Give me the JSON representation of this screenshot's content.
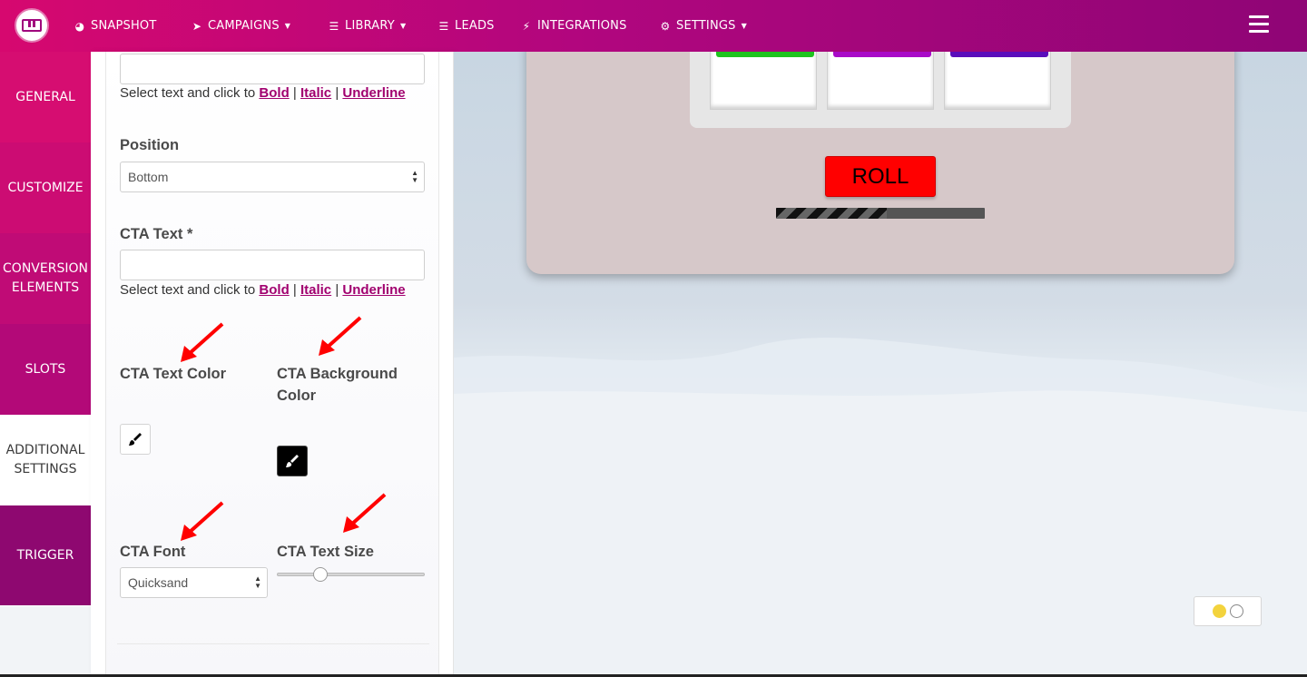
{
  "nav": {
    "items": [
      {
        "label": "SNAPSHOT",
        "icon": "dashboard-icon"
      },
      {
        "label": "CAMPAIGNS",
        "icon": "paper-plane-icon"
      },
      {
        "label": "LIBRARY",
        "icon": "list-icon"
      },
      {
        "label": "LEADS",
        "icon": "list-icon"
      },
      {
        "label": "INTEGRATIONS",
        "icon": "plug-icon"
      },
      {
        "label": "SETTINGS",
        "icon": "gears-icon"
      }
    ]
  },
  "sidebar": {
    "items": [
      {
        "label": "GENERAL"
      },
      {
        "label": "CUSTOMIZE"
      },
      {
        "label": "CONVERSION ELEMENTS"
      },
      {
        "label": "SLOTS"
      },
      {
        "label": "ADDITIONAL SETTINGS",
        "active": true
      },
      {
        "label": "TRIGGER"
      }
    ]
  },
  "form": {
    "top_input_value": "",
    "hint1": {
      "prefix": "Select text and click to ",
      "bold": "Bold",
      "sep1": " | ",
      "italic": "Italic",
      "sep2": " | ",
      "underline": "Underline"
    },
    "position_label": "Position",
    "position_value": "Bottom",
    "cta_text_label": "CTA Text *",
    "cta_text_value": "",
    "hint2": {
      "prefix": "Select text and click to ",
      "bold": "Bold",
      "sep1": " | ",
      "italic": "Italic",
      "sep2": " | ",
      "underline": "Underline"
    },
    "cta_text_color_label": "CTA Text Color",
    "cta_bg_color_label": "CTA Background Color",
    "cta_font_label": "CTA Font",
    "cta_font_value": "Quicksand",
    "cta_text_size_label": "CTA Text Size",
    "cta_text_size_level": 0.27
  },
  "preview": {
    "reel_colors": [
      "#1ec31e",
      "#a90ac8",
      "#5a0dbb"
    ],
    "roll_label": "ROLL",
    "progress": 0.53
  },
  "colors": {
    "accent": "#a1006f",
    "roll_button": "#ff0000",
    "annotation_arrow": "#ff0000"
  }
}
